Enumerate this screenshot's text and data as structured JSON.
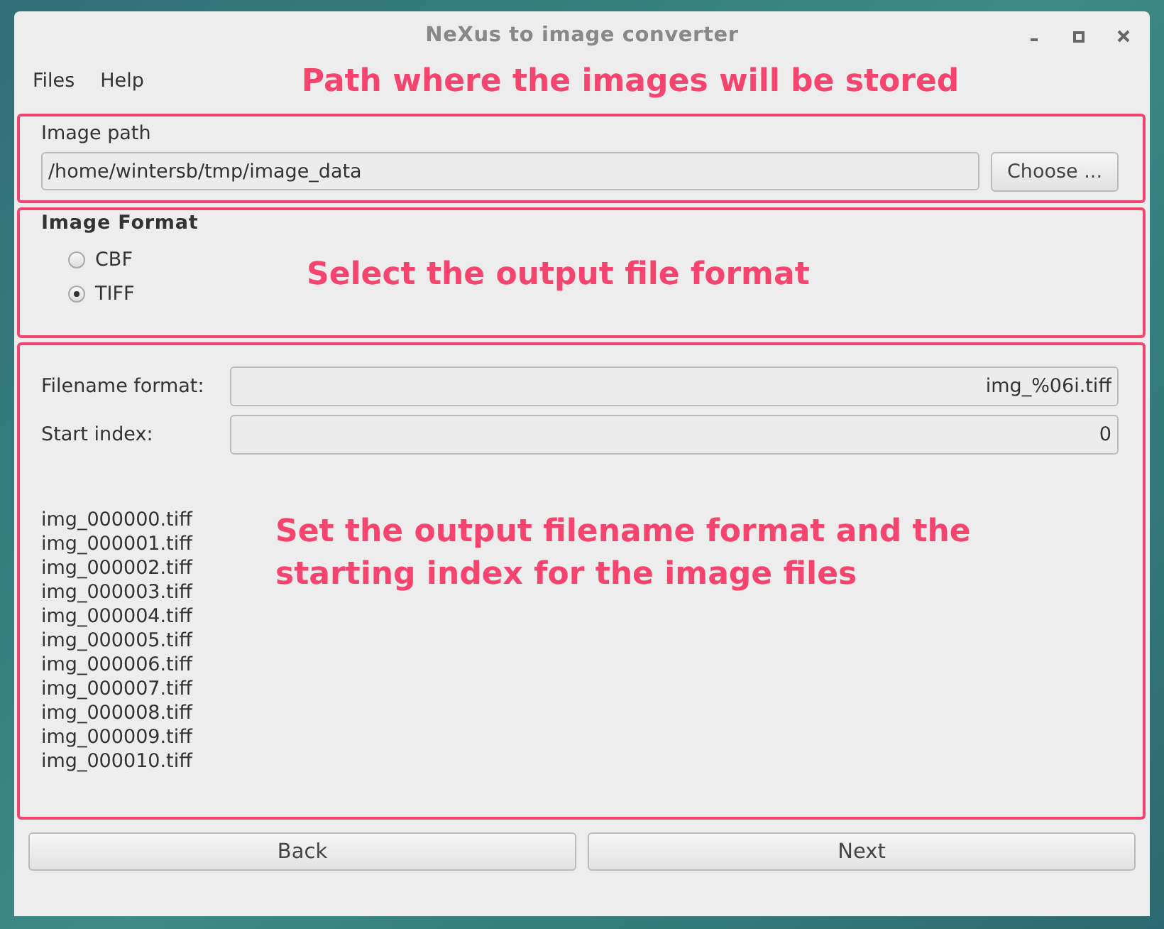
{
  "window": {
    "title": "NeXus to image converter"
  },
  "menu": [
    "Files",
    "Help"
  ],
  "path_section": {
    "annotation": "Path where the images will be stored",
    "label": "Image path",
    "value": "/home/wintersb/tmp/image_data",
    "button": "Choose ..."
  },
  "format_section": {
    "title": "Image Format",
    "annotation": "Select the output file format",
    "options": [
      {
        "label": "CBF",
        "selected": false
      },
      {
        "label": "TIFF",
        "selected": true
      }
    ]
  },
  "filename_section": {
    "annotation": "Set the output filename format and the starting index for the image files",
    "fields": [
      {
        "label": "Filename format:",
        "value": "img_%06i.tiff"
      },
      {
        "label": "Start index:",
        "value": "0"
      }
    ],
    "preview": [
      "img_000000.tiff",
      "img_000001.tiff",
      "img_000002.tiff",
      "img_000003.tiff",
      "img_000004.tiff",
      "img_000005.tiff",
      "img_000006.tiff",
      "img_000007.tiff",
      "img_000008.tiff",
      "img_000009.tiff",
      "img_000010.tiff"
    ]
  },
  "buttons": [
    "Back",
    "Next"
  ]
}
